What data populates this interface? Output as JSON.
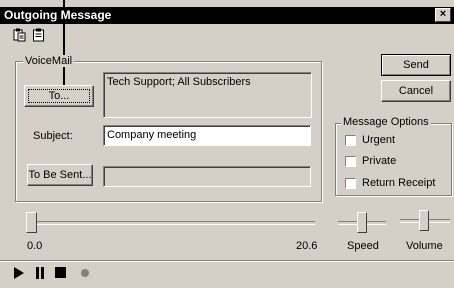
{
  "window": {
    "title": "Outgoing Message",
    "close_glyph": "×"
  },
  "toolbar": {
    "icons": [
      "copy-icon",
      "paste-icon"
    ]
  },
  "voicemail": {
    "group_label": "VoiceMail",
    "to_button": "To...",
    "to_value": "Tech Support; All Subscribers",
    "subject_label": "Subject:",
    "subject_value": "Company meeting",
    "to_be_sent_button": "To Be Sent...",
    "to_be_sent_value": ""
  },
  "actions": {
    "send": "Send",
    "cancel": "Cancel"
  },
  "options": {
    "group_label": "Message Options",
    "items": [
      {
        "label": "Urgent",
        "checked": false
      },
      {
        "label": "Private",
        "checked": false
      },
      {
        "label": "Return Receipt",
        "checked": false
      }
    ]
  },
  "playback": {
    "position_start": "0.0",
    "position_end": "20.6",
    "position_value": 0.0,
    "speed_label": "Speed",
    "speed_value": 0.5,
    "volume_label": "Volume",
    "volume_value": 0.5,
    "controls": [
      "play-icon",
      "pause-icon",
      "stop-icon",
      "record-icon"
    ],
    "colors": {
      "record": "#808080"
    }
  }
}
